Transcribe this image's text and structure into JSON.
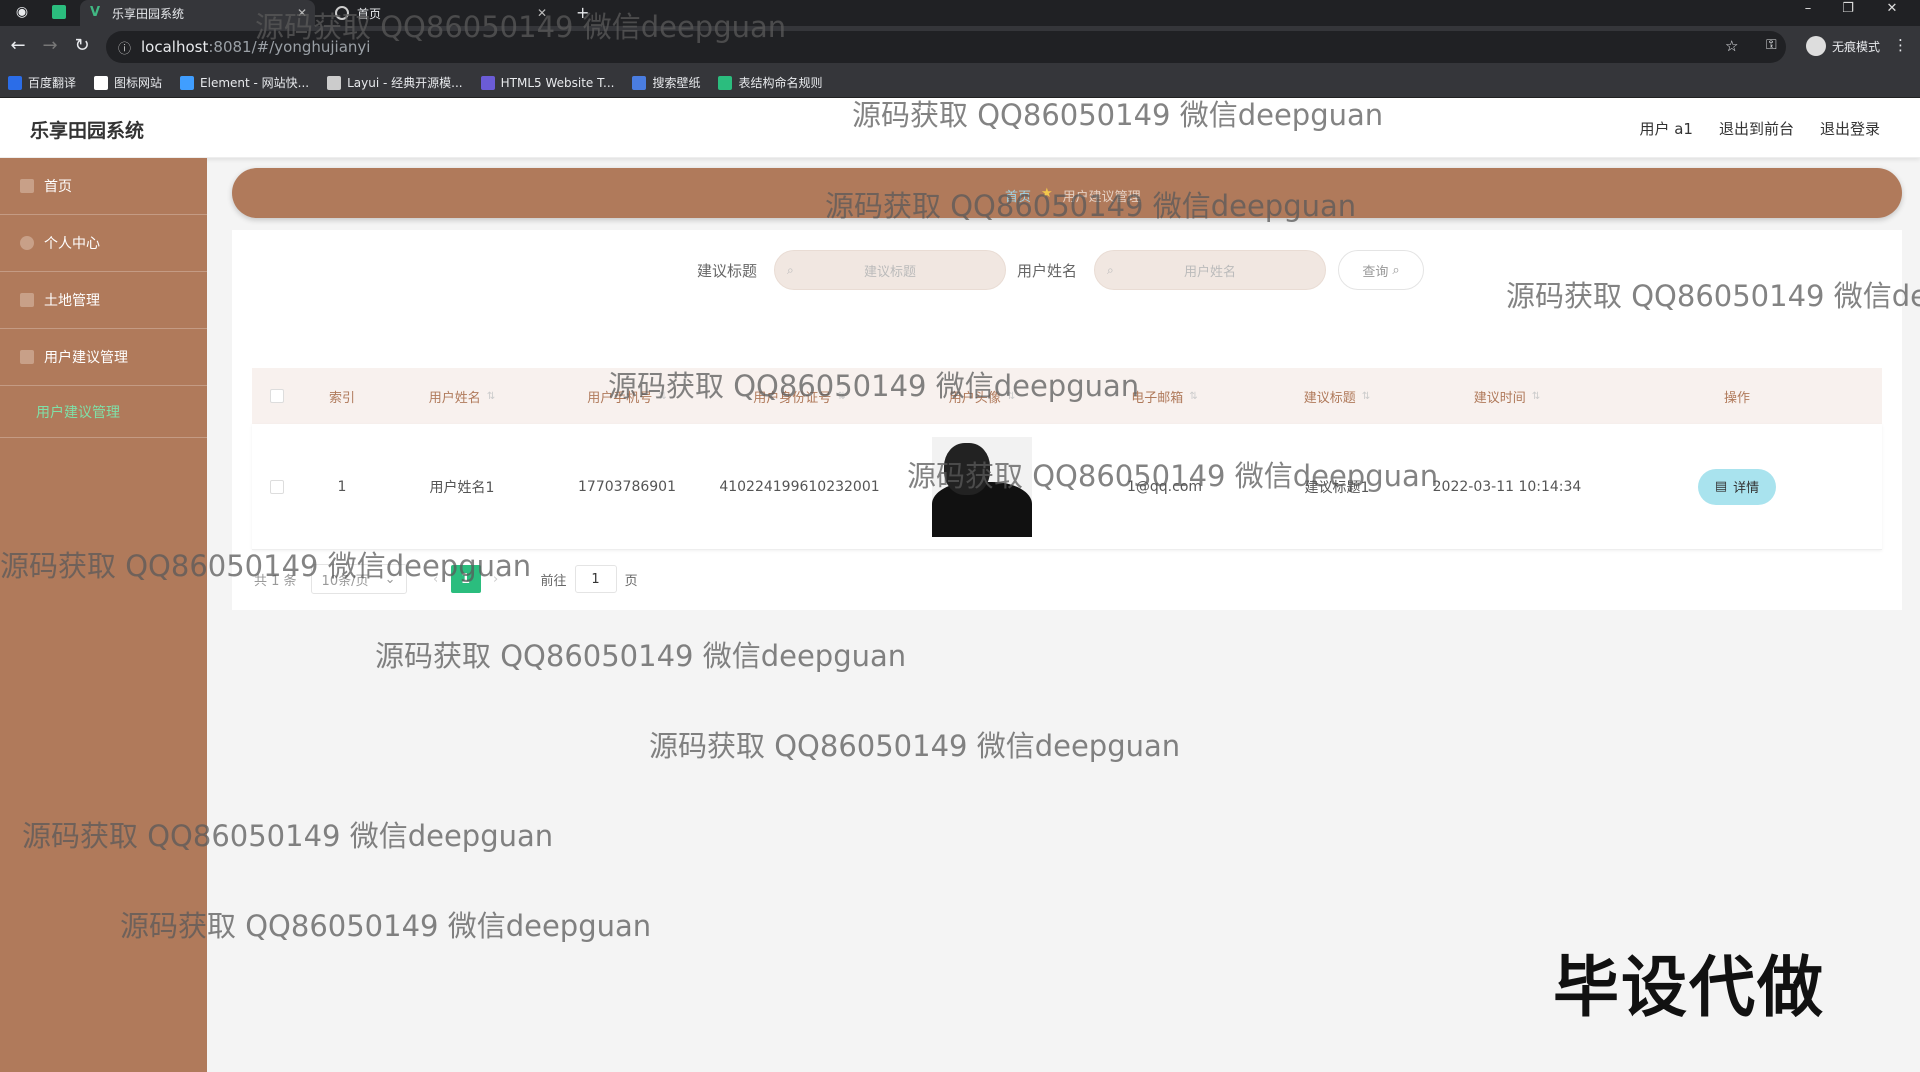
{
  "browser": {
    "tabs": [
      {
        "title": "乐享田园系统",
        "active": true
      },
      {
        "title": "首页",
        "active": false
      }
    ],
    "url_host": "localhost",
    "url_path": ":8081/#/yonghujianyi",
    "profile_label": "无痕模式",
    "bookmarks": [
      {
        "label": "百度翻译",
        "icon": "translate-icon",
        "color": "#2b6de8"
      },
      {
        "label": "图标网站",
        "icon": "flag-icon",
        "color": "#ffffff"
      },
      {
        "label": "Element - 网站快...",
        "icon": "element-icon",
        "color": "#409eff"
      },
      {
        "label": "Layui - 经典开源模...",
        "icon": "layui-icon",
        "color": "#cccccc"
      },
      {
        "label": "HTML5 Website T...",
        "icon": "html5-icon",
        "color": "#6b5cd6"
      },
      {
        "label": "搜索壁纸",
        "icon": "wallpaper-icon",
        "color": "#4a7de0"
      },
      {
        "label": "表结构命名规则",
        "icon": "doc-icon",
        "color": "#2bbd7e"
      }
    ]
  },
  "header": {
    "app_title": "乐享田园系统",
    "links": [
      "用户 a1",
      "退出到前台",
      "退出登录"
    ]
  },
  "sidebar": {
    "items": [
      {
        "label": "首页",
        "icon": "home-icon"
      },
      {
        "label": "个人中心",
        "icon": "user-icon"
      },
      {
        "label": "土地管理",
        "icon": "land-icon"
      },
      {
        "label": "用户建议管理",
        "icon": "mail-icon"
      }
    ],
    "submenu": "用户建议管理"
  },
  "breadcrumb": [
    "首页",
    "用户建议管理"
  ],
  "search": {
    "title_label": "建议标题",
    "title_placeholder": "建议标题",
    "name_label": "用户姓名",
    "name_placeholder": "用户姓名",
    "query_button": "查询"
  },
  "table": {
    "columns": [
      "索引",
      "用户姓名",
      "用户手机号",
      "用户身份证号",
      "用户头像",
      "电子邮箱",
      "建议标题",
      "建议时间",
      "操作"
    ],
    "rows": [
      {
        "index": "1",
        "name": "用户姓名1",
        "phone": "17703786901",
        "id_card": "410224199610232001",
        "email": "1@qq.com",
        "title": "建议标题1",
        "time": "2022-03-11 10:14:34",
        "action": "详情"
      }
    ]
  },
  "pagination": {
    "total": "共 1 条",
    "page_size": "10条/页",
    "current_page": "1",
    "goto_prefix": "前往",
    "goto_value": "1",
    "goto_suffix": "页"
  },
  "watermarks": {
    "text": "源码获取 QQ86050149 微信deepguan",
    "corner": "毕设代做"
  },
  "colors": {
    "sidebar": "#b07a5b",
    "active_submenu": "#7fe0a8",
    "current_page": "#2bbd7e",
    "detail_button": "#a9e3ee"
  }
}
